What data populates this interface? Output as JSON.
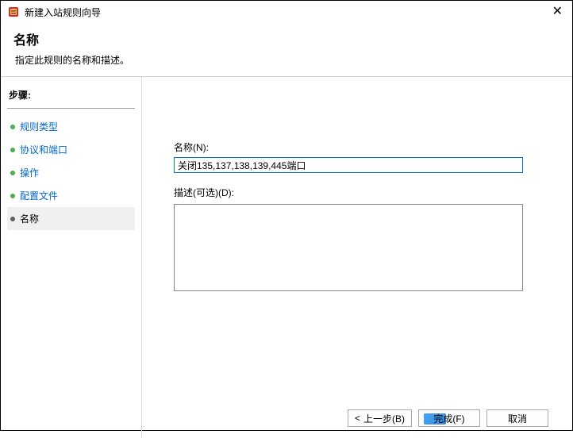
{
  "window": {
    "title": "新建入站规则向导"
  },
  "header": {
    "title": "名称",
    "description": "指定此规则的名称和描述。"
  },
  "sidebar": {
    "title": "步骤:",
    "items": [
      {
        "label": "规则类型",
        "active": false
      },
      {
        "label": "协议和端口",
        "active": false
      },
      {
        "label": "操作",
        "active": false
      },
      {
        "label": "配置文件",
        "active": false
      },
      {
        "label": "名称",
        "active": true
      }
    ]
  },
  "form": {
    "name_label": "名称(N):",
    "name_value": "关闭135,137,138,139,445端口",
    "desc_label": "描述(可选)(D):",
    "desc_value": ""
  },
  "buttons": {
    "back": "上一步(B)",
    "finish": "完成(F)",
    "cancel": "取消"
  }
}
